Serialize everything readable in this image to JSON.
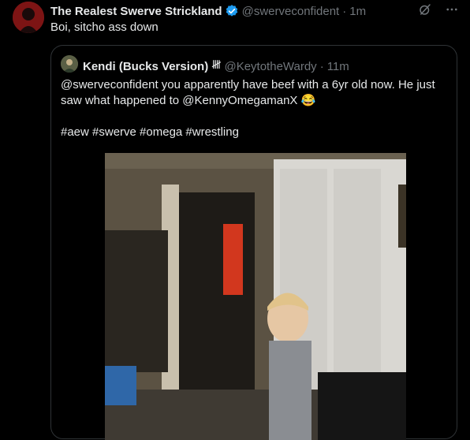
{
  "post": {
    "author_name": "The Realest Swerve Strickland",
    "handle": "@swerveconfident",
    "separator": "·",
    "time": "1m",
    "text": "Boi, sitcho ass down"
  },
  "quote": {
    "author_name": "Kendi (Bucks Version)",
    "name_badge": "𝍸",
    "handle": "@KeytotheWardy",
    "separator": "·",
    "time": "11m",
    "text": "@swerveconfident you apparently have beef with a 6yr old now. He just saw what happened to @KennyOmegamanX 😂",
    "hashtags": "#aew #swerve #omega #wrestling"
  },
  "icons": {
    "verified": "verified-badge-icon",
    "grok": "grok-icon",
    "more": "more-icon"
  },
  "colors": {
    "background": "#000000",
    "text": "#e7e9ea",
    "muted": "#71767b",
    "verified": "#1d9bf0",
    "border": "#2f3336"
  }
}
